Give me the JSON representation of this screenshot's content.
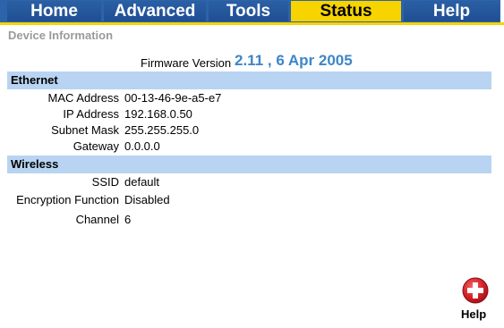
{
  "nav": {
    "tabs": [
      {
        "label": "Home"
      },
      {
        "label": "Advanced"
      },
      {
        "label": "Tools"
      },
      {
        "label": "Status"
      },
      {
        "label": "Help"
      }
    ],
    "active_tab": "Status",
    "colors": {
      "nav_blue": "#2d63a8",
      "active_yellow": "#f7d300"
    }
  },
  "page": {
    "section_title": "Device Information",
    "firmware": {
      "label": "Firmware Version",
      "value": "2.11 , 6 Apr 2005"
    }
  },
  "ethernet": {
    "title": "Ethernet",
    "rows": [
      {
        "label": "MAC Address",
        "value": "00-13-46-9e-a5-e7"
      },
      {
        "label": "IP Address",
        "value": "192.168.0.50"
      },
      {
        "label": "Subnet Mask",
        "value": "255.255.255.0"
      },
      {
        "label": "Gateway",
        "value": "0.0.0.0"
      }
    ]
  },
  "wireless": {
    "title": "Wireless",
    "rows": [
      {
        "label": "SSID",
        "value": "default"
      },
      {
        "label": "Encryption Function",
        "value": "Disabled"
      },
      {
        "label": "Channel",
        "value": "6"
      }
    ]
  },
  "help_button": {
    "label": "Help",
    "icon": "plus-circle-icon",
    "color": "#d42127"
  },
  "colors": {
    "section_bar": "#b8d4f2",
    "firmware_value": "#3d86c6",
    "section_title": "#9a9a9a"
  }
}
